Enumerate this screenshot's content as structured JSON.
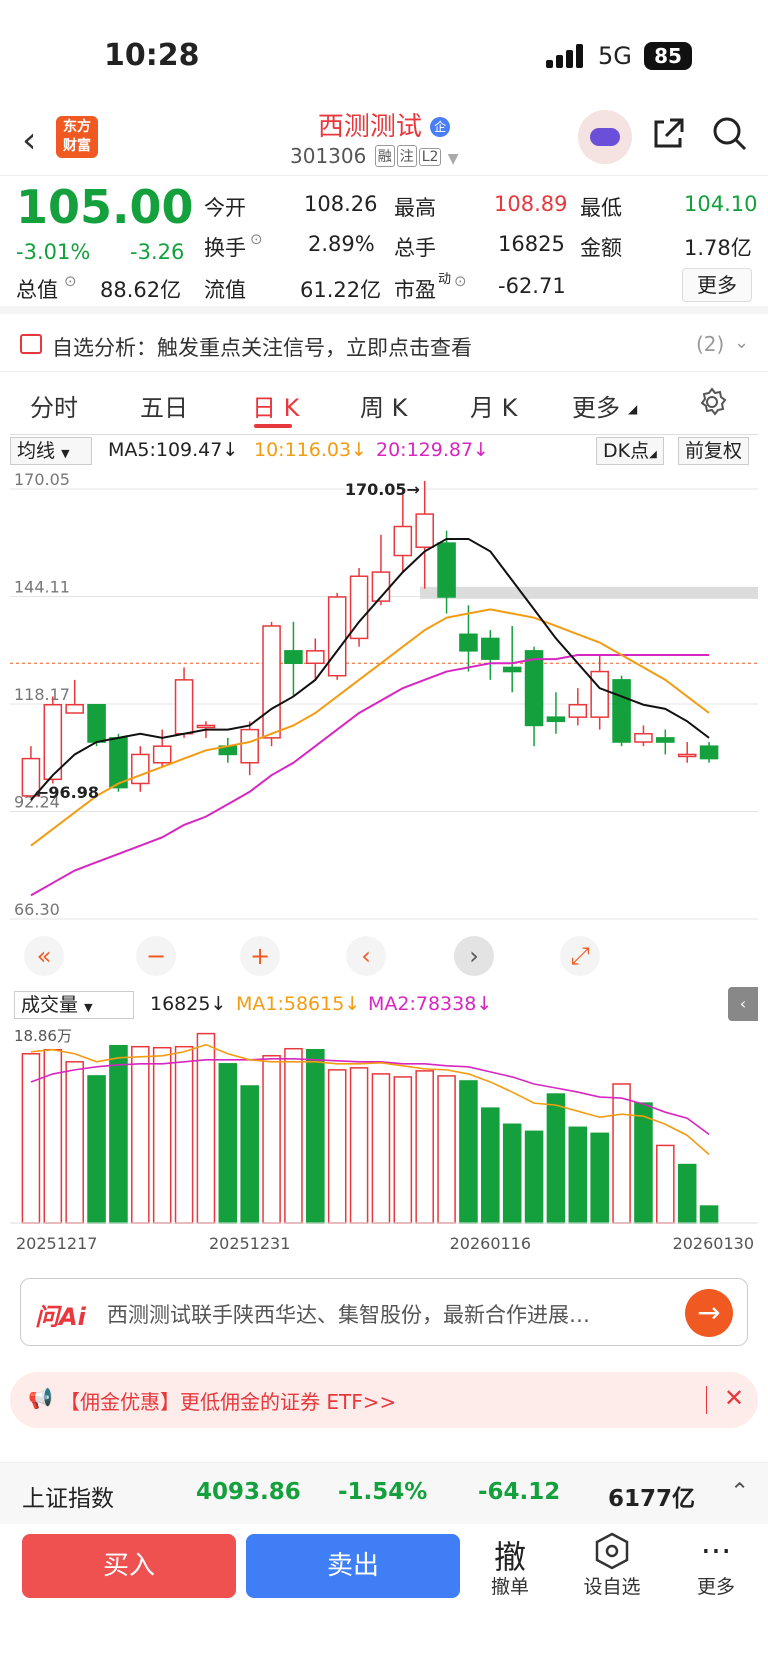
{
  "status": {
    "time": "10:28",
    "network": "5G",
    "battery": "85"
  },
  "header": {
    "back_icon": "chevron-left-icon",
    "logo": "东方财富",
    "name": "西测测试",
    "badge": "企",
    "code": "301306",
    "tags": [
      "融",
      "注",
      "L2"
    ],
    "share_icon": "share-icon",
    "search_icon": "search-icon"
  },
  "quote": {
    "price": "105.00",
    "pct": "-3.01%",
    "change": "-3.26",
    "open_label": "今开",
    "open": "108.26",
    "high_label": "最高",
    "high": "108.89",
    "low_label": "最低",
    "low": "104.10",
    "turnover_label": "换手",
    "turnover": "2.89%",
    "volume_label": "总手",
    "volume": "16825",
    "amount_label": "金额",
    "amount": "1.78亿",
    "mktcap_label": "总值",
    "mktcap": "88.62亿",
    "float_label": "流值",
    "float": "61.22亿",
    "pe_label": "市盈",
    "pe_sup": "动",
    "pe": "-62.71",
    "more": "更多"
  },
  "banner": {
    "text": "自选分析：触发重点关注信号，立即点击查看",
    "count": "(2)"
  },
  "tabs": [
    "分时",
    "五日",
    "日 K",
    "周 K",
    "月 K",
    "更多"
  ],
  "active_tab": "日 K",
  "chart_header": {
    "indicator": "均线",
    "ma5": "MA5:109.47↓",
    "ma10": "10:116.03↓",
    "ma20": "20:129.87↓",
    "dk": "DK点",
    "adjust": "前复权"
  },
  "vol_header": {
    "indicator": "成交量",
    "vol": "16825↓",
    "ma1": "MA1:58615↓",
    "ma2": "MA2:78338↓",
    "ymax": "18.86万"
  },
  "chart_data": {
    "type": "candlestick",
    "y_ticks": [
      "170.05",
      "144.11",
      "118.17",
      "92.24",
      "66.30"
    ],
    "ylim": [
      66.3,
      170.05
    ],
    "max_label": "170.05",
    "min_label": "96.98",
    "x_labels": [
      "20251217",
      "20251231",
      "20260116",
      "20260130"
    ],
    "candles": [
      {
        "o": 96,
        "c": 105,
        "h": 108,
        "l": 96
      },
      {
        "o": 100,
        "c": 118,
        "h": 120,
        "l": 99
      },
      {
        "o": 116,
        "c": 118,
        "h": 124,
        "l": 116
      },
      {
        "o": 118,
        "c": 109,
        "h": 118,
        "l": 108
      },
      {
        "o": 110,
        "c": 98,
        "h": 111,
        "l": 97
      },
      {
        "o": 99,
        "c": 106,
        "h": 108,
        "l": 97
      },
      {
        "o": 104,
        "c": 108,
        "h": 112,
        "l": 103
      },
      {
        "o": 111,
        "c": 124,
        "h": 127,
        "l": 110
      },
      {
        "o": 113,
        "c": 113,
        "h": 114,
        "l": 110
      },
      {
        "o": 108,
        "c": 106,
        "h": 110,
        "l": 104
      },
      {
        "o": 104,
        "c": 112,
        "h": 114,
        "l": 101
      },
      {
        "o": 110,
        "c": 137,
        "h": 138,
        "l": 108
      },
      {
        "o": 131,
        "c": 128,
        "h": 138,
        "l": 120
      },
      {
        "o": 128,
        "c": 131,
        "h": 134,
        "l": 124
      },
      {
        "o": 125,
        "c": 144,
        "h": 145,
        "l": 124
      },
      {
        "o": 134,
        "c": 149,
        "h": 151,
        "l": 132
      },
      {
        "o": 143,
        "c": 150,
        "h": 159,
        "l": 142
      },
      {
        "o": 154,
        "c": 161,
        "h": 170,
        "l": 150
      },
      {
        "o": 156,
        "c": 164,
        "h": 172,
        "l": 146
      },
      {
        "o": 157,
        "c": 144,
        "h": 160,
        "l": 140
      },
      {
        "o": 135,
        "c": 131,
        "h": 142,
        "l": 126
      },
      {
        "o": 134,
        "c": 129,
        "h": 136,
        "l": 124
      },
      {
        "o": 127,
        "c": 126,
        "h": 137,
        "l": 121
      },
      {
        "o": 131,
        "c": 113,
        "h": 132,
        "l": 108
      },
      {
        "o": 115,
        "c": 114,
        "h": 121,
        "l": 111
      },
      {
        "o": 115,
        "c": 118,
        "h": 122,
        "l": 113
      },
      {
        "o": 115,
        "c": 126,
        "h": 130,
        "l": 112
      },
      {
        "o": 124,
        "c": 109,
        "h": 125,
        "l": 108
      },
      {
        "o": 109,
        "c": 111,
        "h": 113,
        "l": 108
      },
      {
        "o": 110,
        "c": 109,
        "h": 112,
        "l": 106
      },
      {
        "o": 106,
        "c": 106,
        "h": 109,
        "l": 104
      },
      {
        "o": 108,
        "c": 105,
        "h": 109,
        "l": 104
      }
    ],
    "ma5": [
      95,
      101,
      106,
      109,
      110,
      111,
      110,
      111,
      112,
      112,
      113,
      117,
      120,
      124,
      131,
      138,
      144,
      150,
      155,
      158,
      158,
      155,
      148,
      141,
      134,
      128,
      122,
      120,
      118,
      117,
      114,
      110
    ],
    "ma10": [
      84,
      88,
      92,
      96,
      99,
      101,
      103,
      105,
      107,
      108,
      109,
      111,
      113,
      116,
      120,
      124,
      128,
      132,
      136,
      139,
      140,
      141,
      140,
      139,
      137,
      135,
      133,
      130,
      127,
      124,
      120,
      116
    ],
    "ma20": [
      72,
      75,
      78,
      80,
      82,
      84,
      86,
      89,
      91,
      94,
      97,
      101,
      104,
      108,
      112,
      116,
      119,
      122,
      124,
      126,
      127,
      128,
      128,
      129,
      129,
      130,
      130,
      130,
      130,
      130,
      130,
      130
    ],
    "volume": {
      "ylim": [
        0,
        188600
      ],
      "values": [
        168000,
        172000,
        160000,
        146000,
        176000,
        175000,
        174000,
        175000,
        188000,
        158000,
        136000,
        166000,
        173000,
        172000,
        152000,
        154000,
        148000,
        145000,
        151000,
        146000,
        141000,
        114000,
        98000,
        91000,
        128000,
        95000,
        89000,
        138000,
        119000,
        77000,
        58000,
        16800
      ],
      "up": [
        true,
        true,
        true,
        false,
        false,
        true,
        true,
        true,
        true,
        false,
        false,
        true,
        true,
        false,
        true,
        true,
        true,
        true,
        true,
        true,
        false,
        false,
        false,
        false,
        false,
        false,
        false,
        true,
        false,
        true,
        false,
        false
      ],
      "ma1": [
        170,
        172,
        168,
        160,
        164,
        165,
        166,
        170,
        177,
        168,
        162,
        160,
        160,
        160,
        158,
        158,
        159,
        156,
        153,
        152,
        148,
        140,
        130,
        119,
        117,
        111,
        105,
        108,
        106,
        98,
        87,
        68
      ],
      "ma2": [
        140,
        148,
        152,
        155,
        157,
        158,
        158,
        160,
        162,
        162,
        162,
        163,
        163,
        162,
        161,
        160,
        160,
        158,
        158,
        156,
        155,
        150,
        145,
        138,
        134,
        130,
        125,
        124,
        118,
        110,
        104,
        88
      ]
    }
  },
  "ai": {
    "logo": "问Ai",
    "text": "西测测试联手陕西华达、集智股份，最新合作进展…"
  },
  "promo": {
    "text": "【佣金优惠】更低佣金的证券 ETF>>"
  },
  "index_bar": {
    "name": "上证指数",
    "value": "4093.86",
    "pct": "-1.54%",
    "chg": "-64.12",
    "amount": "6177亿"
  },
  "bottom": {
    "buy": "买入",
    "sell": "卖出",
    "cancel_glyph": "撤",
    "cancel": "撤单",
    "alert": "设自选",
    "more": "更多"
  },
  "colors": {
    "up": "#e8383d",
    "down": "#14a03c",
    "ma5": "#111111",
    "ma10": "#f39c12",
    "ma20": "#d726c2"
  }
}
